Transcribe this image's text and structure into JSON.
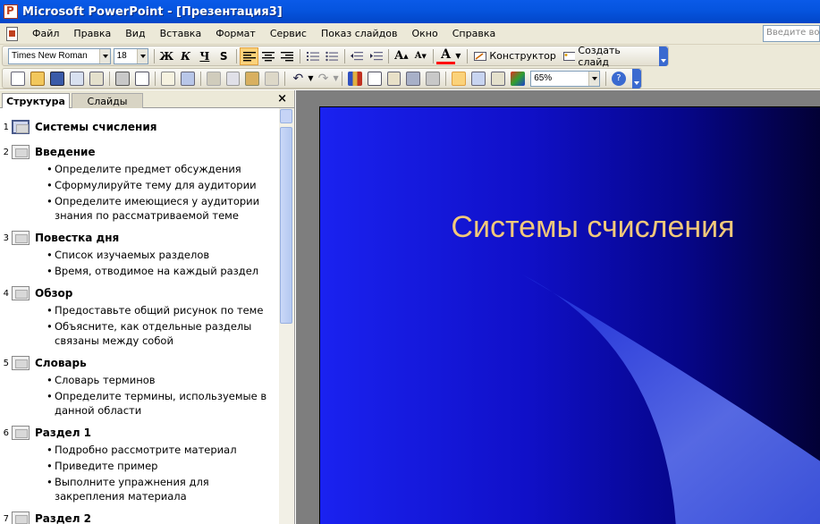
{
  "window": {
    "title": "Microsoft PowerPoint - [Презентация3]"
  },
  "menu": {
    "items": [
      "Файл",
      "Правка",
      "Вид",
      "Вставка",
      "Формат",
      "Сервис",
      "Показ слайдов",
      "Окно",
      "Справка"
    ],
    "ask_placeholder": "Введите воп"
  },
  "formatting_toolbar": {
    "font": "Times New Roman",
    "size": "18",
    "bold": "Ж",
    "italic": "К",
    "underline": "Ч",
    "shadow": "S",
    "designer_label": "Конструктор",
    "new_slide_label": "Создать слайд"
  },
  "standard_toolbar": {
    "zoom": "65%"
  },
  "pane": {
    "tab_structure": "Структура",
    "tab_slides": "Слайды",
    "close": "×"
  },
  "outline": [
    {
      "num": "1",
      "title": "Системы счисления",
      "bullets": []
    },
    {
      "num": "2",
      "title": "Введение",
      "bullets": [
        "Определите предмет обсуждения",
        "Сформулируйте тему для аудитории",
        "Определите имеющиеся у аудитории знания по рассматриваемой теме"
      ]
    },
    {
      "num": "3",
      "title": "Повестка дня",
      "bullets": [
        "Список изучаемых разделов",
        "Время, отводимое на каждый раздел"
      ]
    },
    {
      "num": "4",
      "title": "Обзор",
      "bullets": [
        "Предоставьте общий рисунок по теме",
        "Объясните, как отдельные разделы связаны между собой"
      ]
    },
    {
      "num": "5",
      "title": "Словарь",
      "bullets": [
        "Словарь терминов",
        "Определите термины, используемые в данной области"
      ]
    },
    {
      "num": "6",
      "title": "Раздел 1",
      "bullets": [
        "Подробно рассмотрите материал",
        "Приведите пример",
        "Выполните упражнения для закрепления материала"
      ]
    },
    {
      "num": "7",
      "title": "Раздел 2",
      "bullets": []
    }
  ],
  "slide": {
    "title": "Системы счисления"
  },
  "colors": {
    "title_bar": "#0655e0",
    "slide_bg": "#1010c8",
    "slide_title": "#f2c97a",
    "active_button": "#fbd27a"
  }
}
